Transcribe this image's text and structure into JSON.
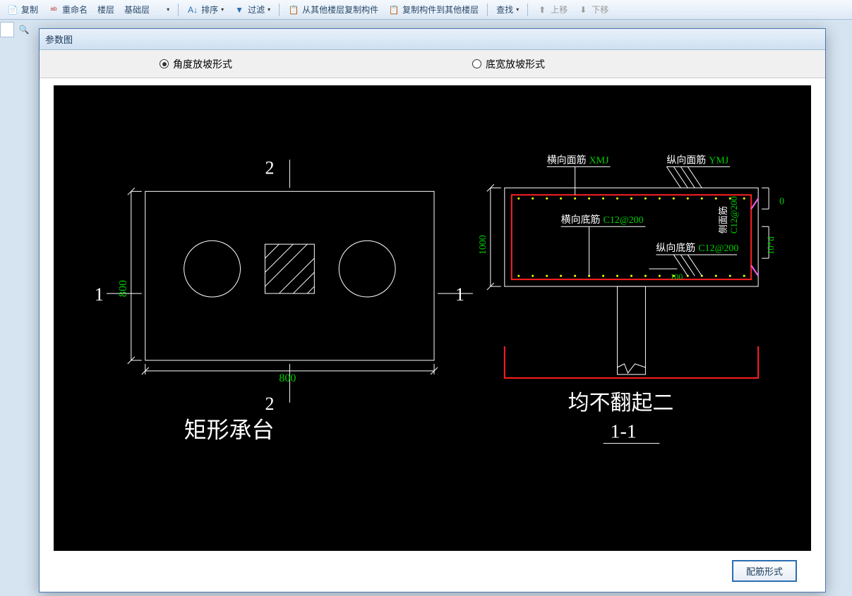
{
  "toolbar": {
    "copy": "复制",
    "rename": "重命名",
    "floor": "楼层",
    "base_layer": "基础层",
    "sort": "排序",
    "filter": "过滤",
    "copy_from_other": "从其他楼层复制构件",
    "copy_to_other": "复制构件到其他楼层",
    "find": "查找",
    "move_up": "上移",
    "move_down": "下移"
  },
  "dialog": {
    "title": "参数图"
  },
  "radios": {
    "angle_slope": "角度放坡形式",
    "bottom_width_slope": "底宽放坡形式"
  },
  "drawing": {
    "left_label_top": "2",
    "left_label_bottom": "2",
    "left_label_left": "1",
    "left_label_right": "1",
    "dim_v_left": "800",
    "dim_h_bottom": "800",
    "left_title": "矩形承台",
    "right_title_1": "均不翻起二",
    "right_title_2": "1-1",
    "dim_section_v": "1000",
    "h_face_bar_label": "横向面筋",
    "h_face_bar_val": "XMJ",
    "v_face_bar_label": "纵向面筋",
    "v_face_bar_val": "YMJ",
    "h_bottom_bar_label": "横向底筋",
    "h_bottom_bar_val": "C12@200",
    "v_bottom_bar_label": "纵向底筋",
    "v_bottom_bar_val": "C12@200",
    "side_bar_label": "侧面筋",
    "side_bar_val": "C12@200",
    "dim_right_0": "0",
    "dim_right_10d": "10*d",
    "dim_inner_100": "100"
  },
  "footer": {
    "button": "配筋形式"
  }
}
